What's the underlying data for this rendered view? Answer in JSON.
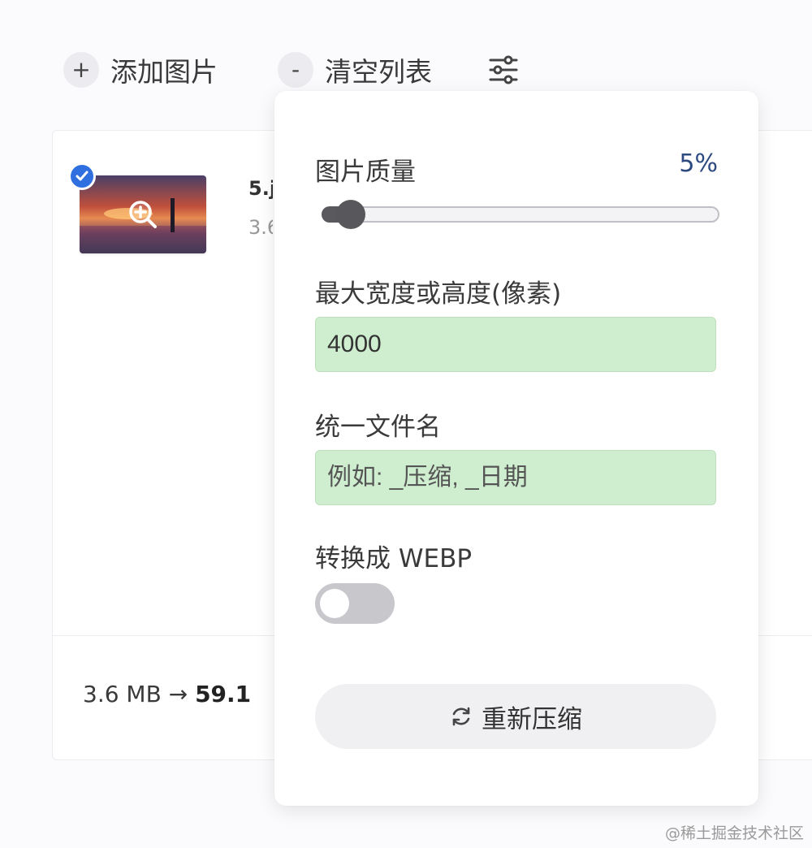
{
  "toolbar": {
    "add_label": "添加图片",
    "add_icon": "+",
    "clear_label": "清空列表",
    "clear_icon": "-",
    "settings_icon": "sliders-icon"
  },
  "file_item": {
    "name_partial": "5.j",
    "size_partial": "3.6",
    "selected": true
  },
  "summary": {
    "original_size": "3.6 MB",
    "arrow": "→",
    "compressed_partial": "59.1"
  },
  "settings": {
    "quality_label": "图片质量",
    "quality_value_text": "5%",
    "quality_value": 5,
    "max_dim_label": "最大宽度或高度(像素)",
    "max_dim_value": "4000",
    "filename_label": "统一文件名",
    "filename_placeholder": "例如: _压缩, _日期",
    "webp_label": "转换成 WEBP",
    "webp_enabled": false,
    "recompress_label": "重新压缩"
  },
  "watermark": "@稀土掘金技术社区",
  "colors": {
    "accent_blue": "#2f6fe0",
    "input_bg": "#cfeecf",
    "quality_value": "#2c4a80"
  }
}
